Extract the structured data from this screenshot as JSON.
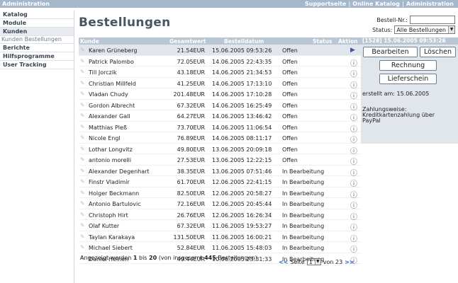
{
  "topbar": {
    "title": "Administration",
    "links": [
      "Supportseite",
      "Online Katalog",
      "Administration"
    ]
  },
  "sidebar": {
    "items": [
      {
        "label": "Katalog"
      },
      {
        "label": "Module"
      },
      {
        "label": "Kunden"
      },
      {
        "label": "Kunden Bestellungen",
        "sub": true
      },
      {
        "label": "Berichte"
      },
      {
        "label": "Hilfsprogramme"
      },
      {
        "label": "User Tracking"
      }
    ]
  },
  "page": {
    "title": "Bestellungen"
  },
  "order_search": {
    "label": "Bestell-Nr.:",
    "value": "",
    "status_label": "Status:",
    "status_selected": "Alle Bestellungen"
  },
  "table": {
    "headers": [
      "Kunde",
      "Gesamtwert",
      "Bestelldatum",
      "Status",
      "Aktion"
    ],
    "rows": [
      {
        "name": "Karen Grüneberg",
        "total": "21.54EUR",
        "date": "15.06.2005 09:53:26",
        "status": "Offen",
        "action": "selected"
      },
      {
        "name": "Patrick Palombo",
        "total": "72.05EUR",
        "date": "14.06.2005 22:43:35",
        "status": "Offen",
        "action": "info"
      },
      {
        "name": "Till Jorczik",
        "total": "43.18EUR",
        "date": "14.06.2005 21:34:53",
        "status": "Offen",
        "action": "info"
      },
      {
        "name": "Christian Millfeld",
        "total": "41.25EUR",
        "date": "14.06.2005 17:13:10",
        "status": "Offen",
        "action": "info"
      },
      {
        "name": "Vladan Chudy",
        "total": "201.48EUR",
        "date": "14.06.2005 17:10:28",
        "status": "Offen",
        "action": "info"
      },
      {
        "name": "Gordon Albrecht",
        "total": "67.32EUR",
        "date": "14.06.2005 16:25:49",
        "status": "Offen",
        "action": "info"
      },
      {
        "name": "Alexander Gall",
        "total": "64.27EUR",
        "date": "14.06.2005 13:46:42",
        "status": "Offen",
        "action": "info"
      },
      {
        "name": "Matthias Pleß",
        "total": "73.70EUR",
        "date": "14.06.2005 11:06:54",
        "status": "Offen",
        "action": "info"
      },
      {
        "name": "Nicole Engl",
        "total": "76.89EUR",
        "date": "14.06.2005 08:11:17",
        "status": "Offen",
        "action": "info"
      },
      {
        "name": "Lothar Longvitz",
        "total": "49.80EUR",
        "date": "13.06.2005 20:09:18",
        "status": "Offen",
        "action": "info"
      },
      {
        "name": "antonio morelli",
        "total": "27.53EUR",
        "date": "13.06.2005 12:22:15",
        "status": "Offen",
        "action": "info"
      },
      {
        "name": "Alexander Degenhart",
        "total": "38.35EUR",
        "date": "13.06.2005 07:51:46",
        "status": "In Bearbeitung",
        "action": "info"
      },
      {
        "name": "Finstr Vladimír",
        "total": "61.70EUR",
        "date": "12.06.2005 22:41:15",
        "status": "In Bearbeitung",
        "action": "info"
      },
      {
        "name": "Holger Beckmann",
        "total": "82.50EUR",
        "date": "12.06.2005 20:58:27",
        "status": "In Bearbeitung",
        "action": "info"
      },
      {
        "name": "Antonio Bartulovic",
        "total": "72.16EUR",
        "date": "12.06.2005 20:45:44",
        "status": "In Bearbeitung",
        "action": "info"
      },
      {
        "name": "Christoph Hirt",
        "total": "26.76EUR",
        "date": "12.06.2005 16:26:34",
        "status": "In Bearbeitung",
        "action": "info"
      },
      {
        "name": "Olaf Kutter",
        "total": "67.32EUR",
        "date": "11.06.2005 19:53:27",
        "status": "In Bearbeitung",
        "action": "info"
      },
      {
        "name": "Taylan Karakaya",
        "total": "131.50EUR",
        "date": "11.06.2005 16:00:21",
        "status": "In Bearbeitung",
        "action": "info"
      },
      {
        "name": "Michael Siebert",
        "total": "52.84EUR",
        "date": "11.06.2005 15:48:03",
        "status": "In Bearbeitung",
        "action": "info"
      },
      {
        "name": "Daniel Heinen",
        "total": "49.44EUR",
        "date": "10.06.2005 23:31:33",
        "status": "In Bearbeitung",
        "action": "info"
      }
    ]
  },
  "footer": {
    "summary_pre": "Angezeigt werden ",
    "from": "1",
    "mid1": " bis ",
    "to": "20",
    "mid2": " (von insgesamt ",
    "total": "445",
    "post": " Bestellungen)",
    "prev": "<<",
    "page_label": "Seite",
    "page_value": "1",
    "of_label": "von 23",
    "next": ">>"
  },
  "detail": {
    "header": "[1528] 15.06.2005 09:53:26",
    "edit_button": "Bearbeiten",
    "delete_button": "Löschen",
    "invoice_button": "Rechnung",
    "delivery_button": "Lieferschein",
    "created": "erstellt am: 15.06.2005",
    "payment_label": "Zahlungsweise:",
    "payment_line1": "Kreditkartenzahlung über",
    "payment_line2": "PayPal"
  },
  "icons": {
    "row_icon": "customer-icon",
    "info": "info-icon",
    "selected": "play-arrow-icon"
  }
}
